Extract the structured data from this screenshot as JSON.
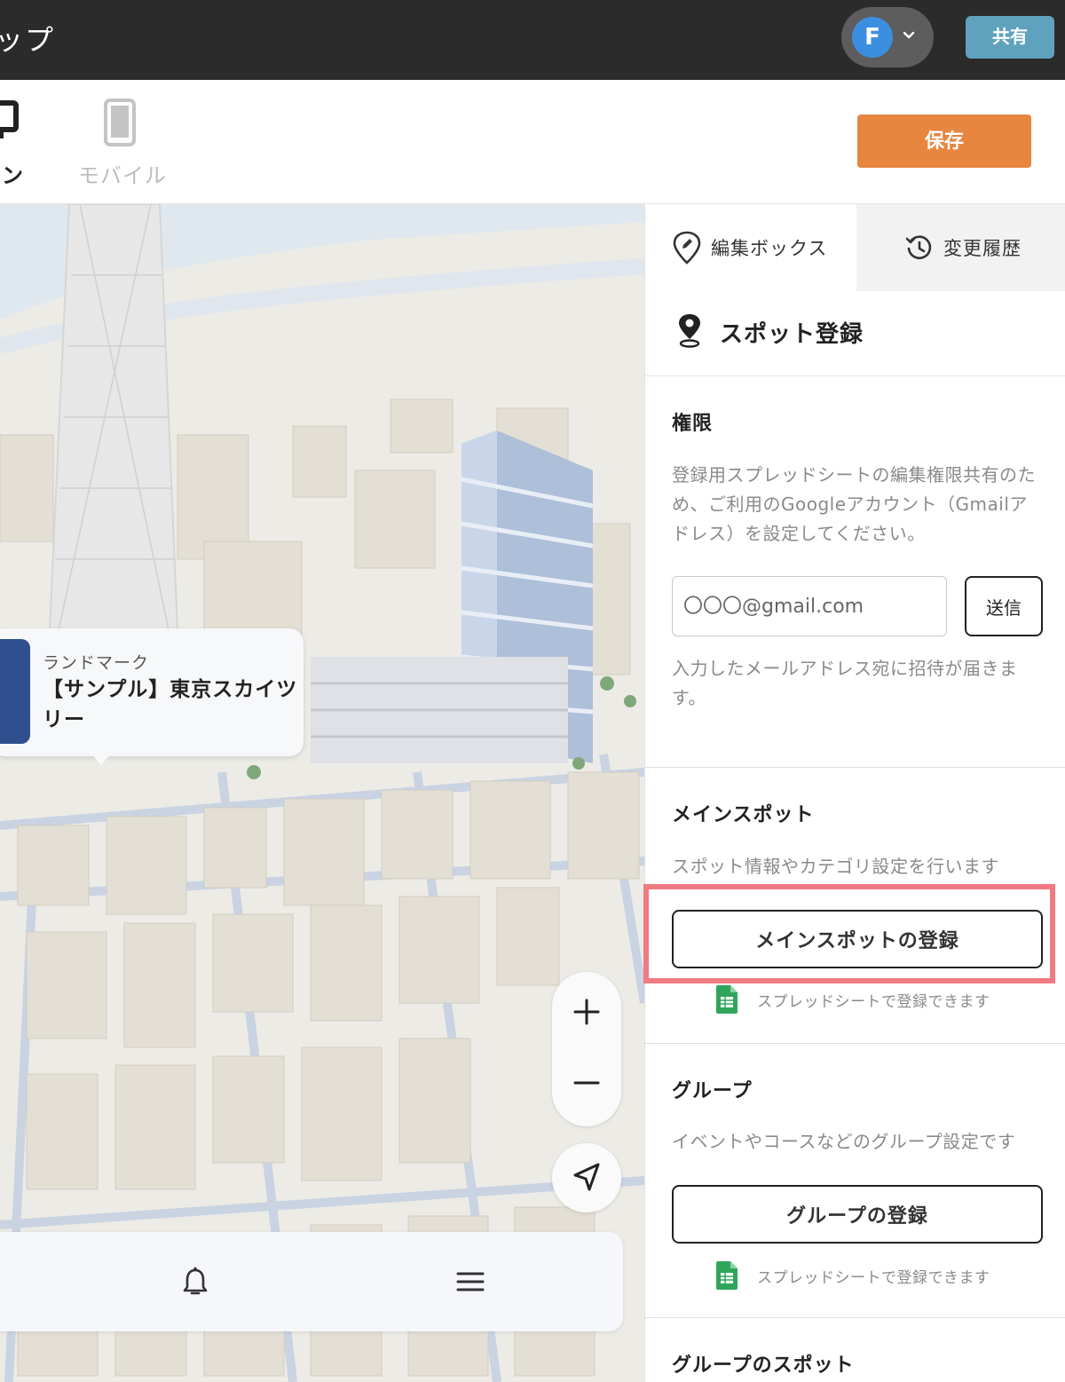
{
  "header": {
    "app_title": "ップ",
    "avatar_letter": "F",
    "share_label": "共有"
  },
  "view_bar": {
    "pc_label": "コン",
    "mobile_label": "モバイル",
    "save_label": "保存"
  },
  "map": {
    "callout": {
      "category": "ランドマーク",
      "name": "【サンプル】東京スカイツリー"
    }
  },
  "panel": {
    "tabs": [
      {
        "label": "編集ボックス",
        "active": true
      },
      {
        "label": "変更履歴",
        "active": false
      }
    ],
    "heading": "スポット登録",
    "permission": {
      "title": "権限",
      "description": "登録用スプレッドシートの編集権限共有のため、ご利用のGoogleアカウント（Gmailアドレス）を設定してください。",
      "email_placeholder": "〇〇〇@gmail.com",
      "send_label": "送信",
      "note": "入力したメールアドレス宛に招待が届きます。"
    },
    "main_spot": {
      "title": "メインスポット",
      "description": "スポット情報やカテゴリ設定を行います",
      "button_label": "メインスポットの登録",
      "sheet_note": "スプレッドシートで登録できます"
    },
    "group": {
      "title": "グループ",
      "description": "イベントやコースなどのグループ設定です",
      "button_label": "グループの登録",
      "sheet_note": "スプレッドシートで登録できます"
    },
    "group_spot": {
      "title": "グループのスポット"
    }
  },
  "colors": {
    "topbar": "#2b2b2b",
    "share": "#5fa2bd",
    "save": "#e8853f",
    "highlight": "#f07a83",
    "sheet_green": "#2fa55a"
  }
}
